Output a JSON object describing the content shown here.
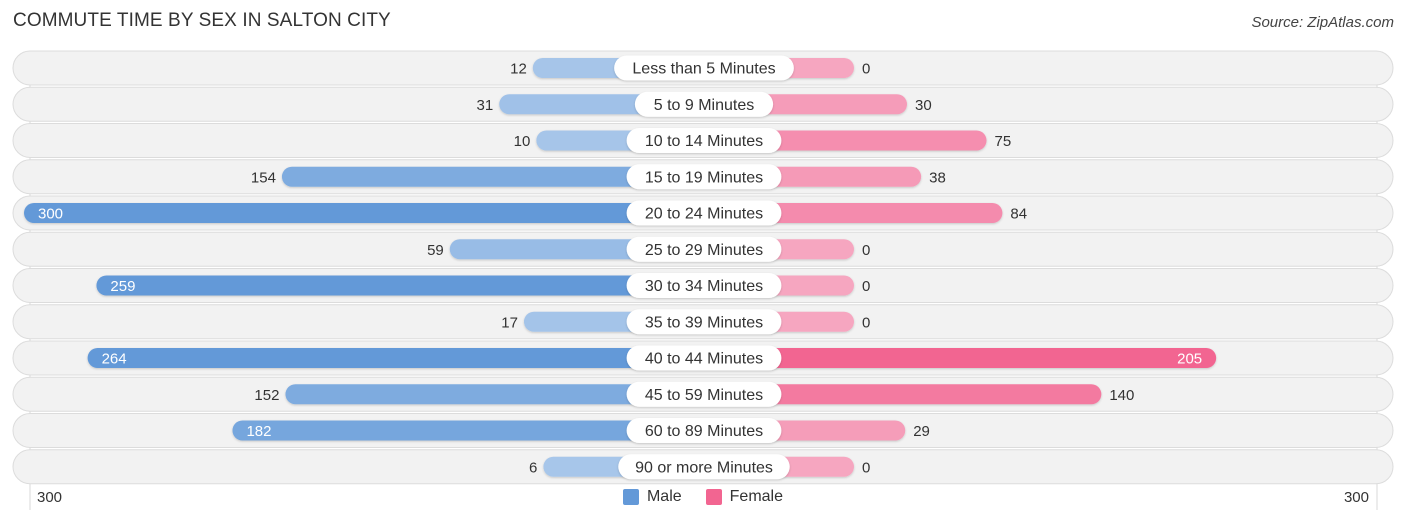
{
  "header": {
    "title": "COMMUTE TIME BY SEX IN SALTON CITY",
    "source": "Source: ZipAtlas.com"
  },
  "colors": {
    "male_strong": "#6399d8",
    "male_light": "#a9c7ea",
    "female_strong": "#f26591",
    "female_light": "#f6a6c0",
    "row_bg": "#f2f2f2",
    "label_bg": "#ffffff"
  },
  "legend": {
    "male_label": "Male",
    "female_label": "Female"
  },
  "axis": {
    "left_label": "300",
    "right_label": "300"
  },
  "chart_data": {
    "type": "bar",
    "orientation": "horizontal-diverging",
    "title": "COMMUTE TIME BY SEX IN SALTON CITY",
    "categories": [
      "Less than 5 Minutes",
      "5 to 9 Minutes",
      "10 to 14 Minutes",
      "15 to 19 Minutes",
      "20 to 24 Minutes",
      "25 to 29 Minutes",
      "30 to 34 Minutes",
      "35 to 39 Minutes",
      "40 to 44 Minutes",
      "45 to 59 Minutes",
      "60 to 89 Minutes",
      "90 or more Minutes"
    ],
    "series": [
      {
        "name": "Male",
        "values": [
          12,
          31,
          10,
          154,
          300,
          59,
          259,
          17,
          264,
          152,
          182,
          6
        ]
      },
      {
        "name": "Female",
        "values": [
          0,
          30,
          75,
          38,
          84,
          0,
          0,
          0,
          205,
          140,
          29,
          0
        ]
      }
    ],
    "xlim": [
      -300,
      300
    ],
    "xlabel": "",
    "ylabel": "",
    "legend_position": "bottom-center",
    "grid": false
  }
}
